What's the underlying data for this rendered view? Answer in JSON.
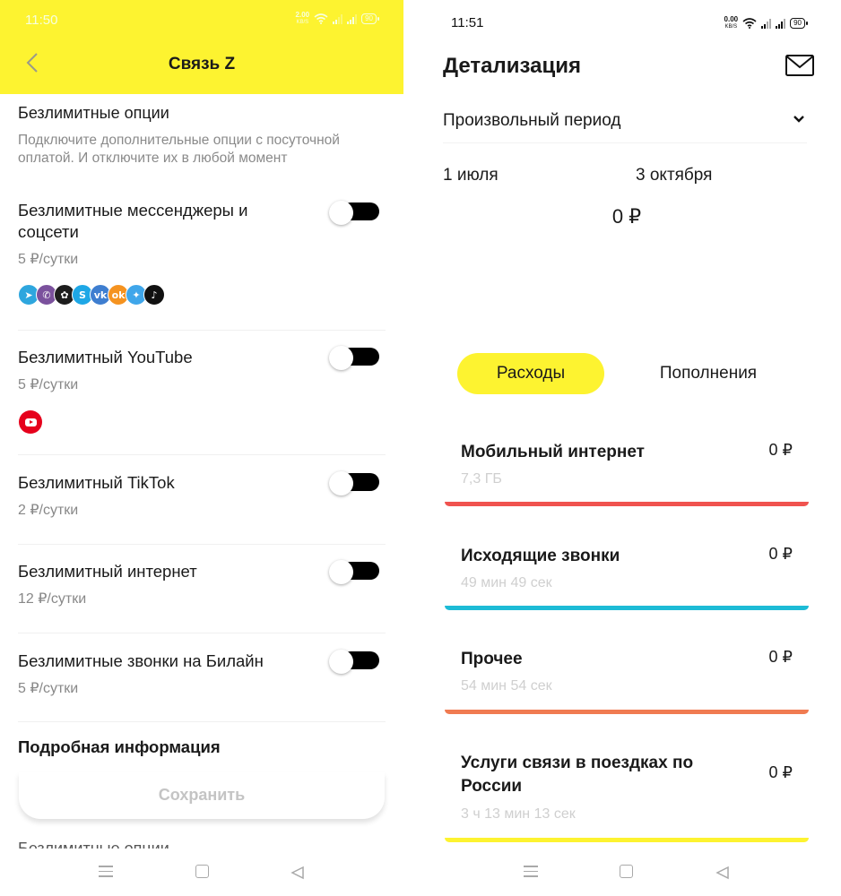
{
  "left": {
    "status": {
      "time": "11:50",
      "net_value": "2.00",
      "net_unit": "KB/S",
      "battery": "90"
    },
    "header": {
      "title": "Связь Z"
    },
    "section": {
      "title": "Безлимитные опции",
      "description": "Подключите дополнительные опции с посуточной оплатой. И отключите их в любой момент"
    },
    "options": [
      {
        "name": "Безлимитные мессенджеры и соцсети",
        "price": "5 ₽/сутки",
        "enabled": false
      },
      {
        "name": "Безлимитный YouTube",
        "price": "5 ₽/сутки",
        "enabled": false
      },
      {
        "name": "Безлимитный TikTok",
        "price": "2 ₽/сутки",
        "enabled": false
      },
      {
        "name": "Безлимитный интернет",
        "price": "12 ₽/сутки",
        "enabled": false
      },
      {
        "name": "Безлимитные звонки на Билайн",
        "price": "5 ₽/сутки",
        "enabled": false
      }
    ],
    "messenger_icons": [
      {
        "icon": "telegram-icon",
        "glyph": "➤",
        "color": "#2ea6de"
      },
      {
        "icon": "viber-icon",
        "glyph": "✆",
        "color": "#7b519d"
      },
      {
        "icon": "icq-icon",
        "glyph": "✿",
        "color": "#1d1d1d"
      },
      {
        "icon": "skype-icon",
        "glyph": "S",
        "color": "#1ea7e6"
      },
      {
        "icon": "vk-icon",
        "glyph": "vk",
        "color": "#3e7ed0"
      },
      {
        "icon": "odnoklassniki-icon",
        "glyph": "ok",
        "color": "#f59320"
      },
      {
        "icon": "twitter-icon",
        "glyph": "✦",
        "color": "#3fa6ea"
      },
      {
        "icon": "tiktok-icon",
        "glyph": "♪",
        "color": "#111111"
      }
    ],
    "details_link": "Подробная информация",
    "save_button": "Сохранить",
    "below_fold_text": "Безлимитные опции",
    "accent_color": "#fdf330"
  },
  "right": {
    "status": {
      "time": "11:51",
      "net_value": "0.00",
      "net_unit": "KB/S",
      "battery": "90"
    },
    "title": "Детализация",
    "period_select": "Произвольный период",
    "date_from": "1 июля",
    "date_to": "3 октября",
    "total": "0 ₽",
    "tabs": [
      {
        "label": "Расходы",
        "active": true
      },
      {
        "label": "Пополнения",
        "active": false
      }
    ],
    "categories": [
      {
        "name": "Мобильный интернет",
        "amount": "0 ₽",
        "detail": "7,3 ГБ",
        "color": "#f0534f"
      },
      {
        "name": "Исходящие звонки",
        "amount": "0 ₽",
        "detail": "49 мин 49 сек",
        "color": "#1dbbd6"
      },
      {
        "name": "Прочее",
        "amount": "0 ₽",
        "detail": "54 мин 54 сек",
        "color": "#f07b51"
      },
      {
        "name": "Услуги связи в поездках по России",
        "amount": "0 ₽",
        "detail": "3 ч 13 мин 13 сек",
        "color": "#fdf330"
      }
    ]
  }
}
